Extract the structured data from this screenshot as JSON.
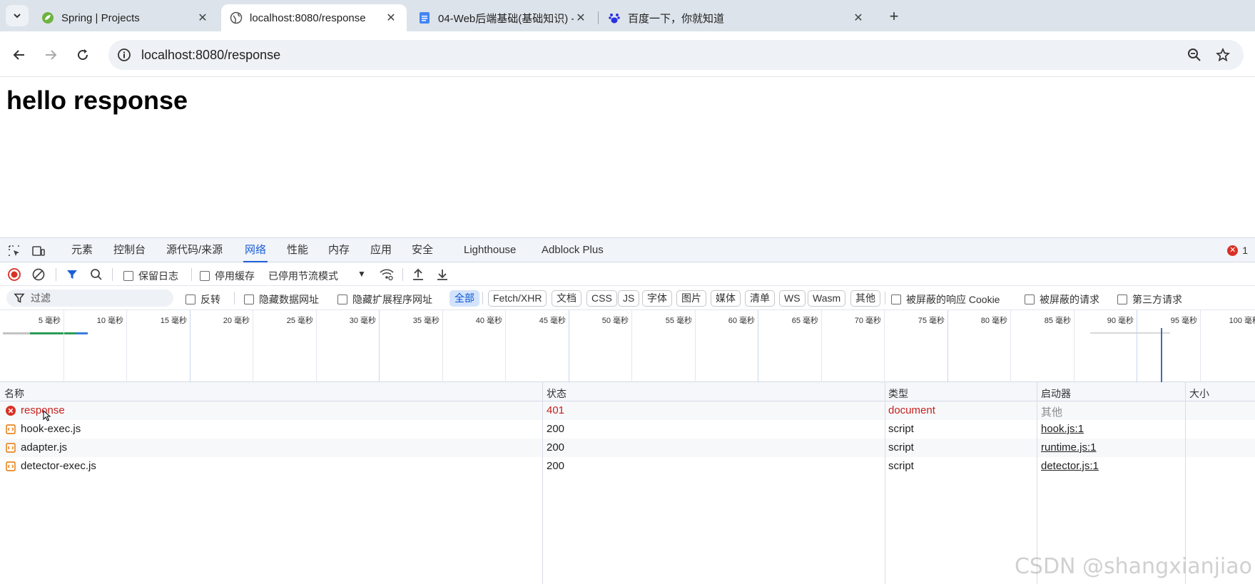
{
  "browser": {
    "tabs": [
      {
        "title": "Spring | Projects",
        "icon": "spring-leaf-icon",
        "active": false
      },
      {
        "title": "localhost:8080/response",
        "icon": "globe-icon",
        "active": true
      },
      {
        "title": "04-Web后端基础(基础知识) -",
        "icon": "doc-icon",
        "active": false
      },
      {
        "title": "百度一下，你就知道",
        "icon": "baidu-paw-icon",
        "active": false
      }
    ],
    "address": "localhost:8080/response"
  },
  "page": {
    "heading": "hello response"
  },
  "devtools": {
    "tabs": [
      "元素",
      "控制台",
      "源代码/来源",
      "网络",
      "性能",
      "内存",
      "应用",
      "安全",
      "Lighthouse",
      "Adblock Plus"
    ],
    "active_tab": "网络",
    "error_count": "1",
    "network_toolbar": {
      "preserve_log": "保留日志",
      "disable_cache": "停用缓存",
      "throttle": "已停用节流模式"
    },
    "filter": {
      "placeholder": "过滤",
      "invert": "反转",
      "hide_data_urls": "隐藏数据网址",
      "hide_extension_urls": "隐藏扩展程序网址",
      "types": [
        "全部",
        "Fetch/XHR",
        "文档",
        "CSS",
        "JS",
        "字体",
        "图片",
        "媒体",
        "清单",
        "WS",
        "Wasm",
        "其他"
      ],
      "active_type": "全部",
      "blocked_cookies": "被屏蔽的响应 Cookie",
      "blocked_requests": "被屏蔽的请求",
      "third_party": "第三方请求"
    },
    "timeline": {
      "ticks": [
        "5 毫秒",
        "10 毫秒",
        "15 毫秒",
        "20 毫秒",
        "25 毫秒",
        "30 毫秒",
        "35 毫秒",
        "40 毫秒",
        "45 毫秒",
        "50 毫秒",
        "55 毫秒",
        "60 毫秒",
        "65 毫秒",
        "70 毫秒",
        "75 毫秒",
        "80 毫秒",
        "85 毫秒",
        "90 毫秒",
        "95 毫秒",
        "100 毫秒"
      ]
    },
    "columns": [
      "名称",
      "状态",
      "类型",
      "启动器",
      "大小"
    ],
    "requests": [
      {
        "name": "response",
        "status": "401",
        "type": "document",
        "initiator": "其他",
        "error": true
      },
      {
        "name": "hook-exec.js",
        "status": "200",
        "type": "script",
        "initiator": "hook.js:1",
        "error": false
      },
      {
        "name": "adapter.js",
        "status": "200",
        "type": "script",
        "initiator": "runtime.js:1",
        "error": false
      },
      {
        "name": "detector-exec.js",
        "status": "200",
        "type": "script",
        "initiator": "detector.js:1",
        "error": false
      }
    ]
  },
  "watermark": "CSDN @shangxianjiao",
  "colors": {
    "accent": "#1a5fd6",
    "error": "#c5221f",
    "chrome_bg": "#dde3ea"
  }
}
